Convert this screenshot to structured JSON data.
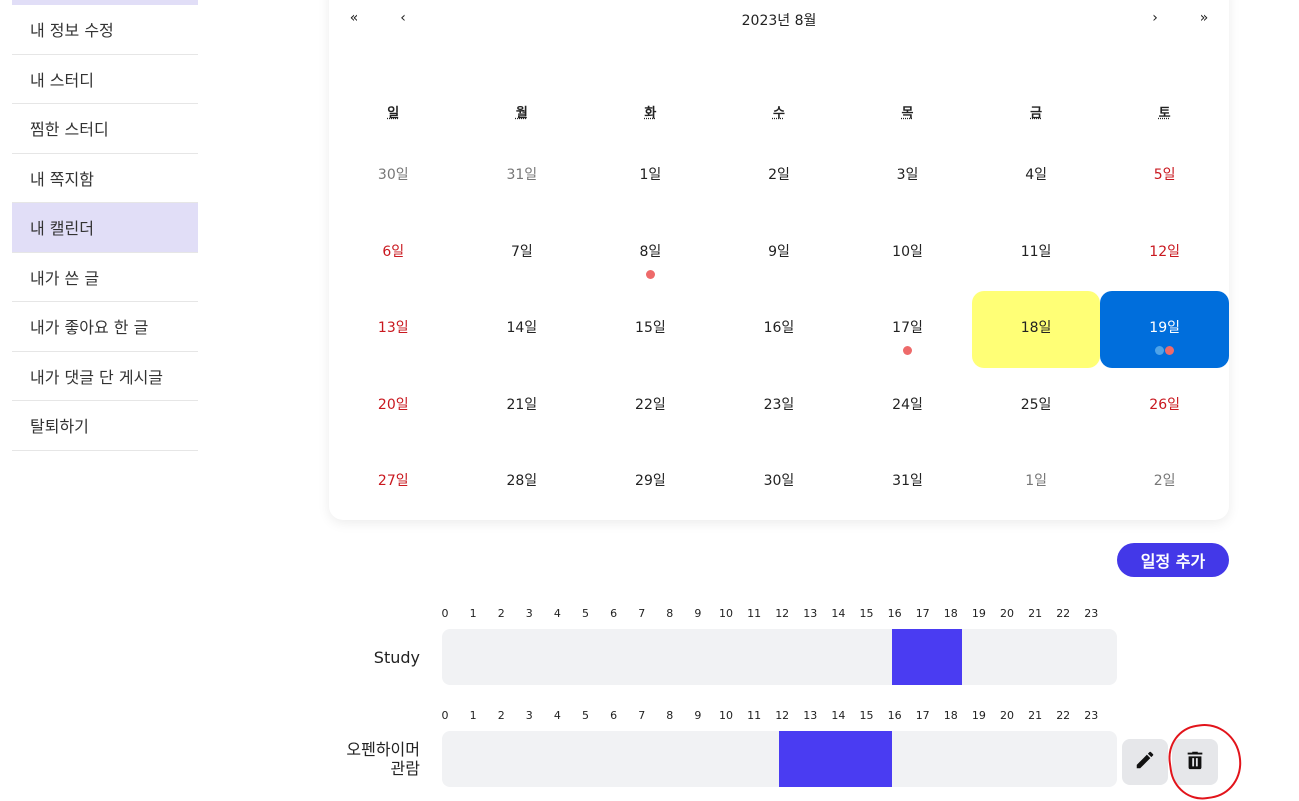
{
  "sidebar": {
    "items": [
      {
        "label": "내 정보 수정"
      },
      {
        "label": "내 스터디"
      },
      {
        "label": "찜한 스터디"
      },
      {
        "label": "내 쪽지함"
      },
      {
        "label": "내 캘린더"
      },
      {
        "label": "내가 쓴 글"
      },
      {
        "label": "내가 좋아요 한 글"
      },
      {
        "label": "내가 댓글 단 게시글"
      },
      {
        "label": "탈퇴하기"
      }
    ]
  },
  "calendar": {
    "title": "2023년 8월",
    "nav": {
      "prev2": "«",
      "prev": "‹",
      "next": "›",
      "next2": "»"
    },
    "weekdays": [
      "일",
      "월",
      "화",
      "수",
      "목",
      "금",
      "토"
    ],
    "weeks": [
      [
        {
          "label": "30일",
          "type": "neighbor"
        },
        {
          "label": "31일",
          "type": "neighbor"
        },
        {
          "label": "1일"
        },
        {
          "label": "2일"
        },
        {
          "label": "3일"
        },
        {
          "label": "4일"
        },
        {
          "label": "5일",
          "type": "weekend"
        }
      ],
      [
        {
          "label": "6일",
          "type": "weekend"
        },
        {
          "label": "7일"
        },
        {
          "label": "8일",
          "dots": [
            "#ee6a6a"
          ]
        },
        {
          "label": "9일"
        },
        {
          "label": "10일"
        },
        {
          "label": "11일"
        },
        {
          "label": "12일",
          "type": "weekend"
        }
      ],
      [
        {
          "label": "13일",
          "type": "weekend"
        },
        {
          "label": "14일"
        },
        {
          "label": "15일"
        },
        {
          "label": "16일"
        },
        {
          "label": "17일",
          "dots": [
            "#ee6a6a"
          ]
        },
        {
          "label": "18일",
          "type": "today"
        },
        {
          "label": "19일",
          "type": "selected",
          "dots": [
            "#4fa3e8",
            "#ee6a6a"
          ]
        }
      ],
      [
        {
          "label": "20일",
          "type": "weekend"
        },
        {
          "label": "21일"
        },
        {
          "label": "22일"
        },
        {
          "label": "23일"
        },
        {
          "label": "24일"
        },
        {
          "label": "25일"
        },
        {
          "label": "26일",
          "type": "weekend"
        }
      ],
      [
        {
          "label": "27일",
          "type": "weekend"
        },
        {
          "label": "28일"
        },
        {
          "label": "29일"
        },
        {
          "label": "30일"
        },
        {
          "label": "31일"
        },
        {
          "label": "1일",
          "type": "neighbor"
        },
        {
          "label": "2일",
          "type": "neighbor"
        }
      ]
    ]
  },
  "add_button": {
    "label": "일정 추가"
  },
  "hours": [
    "0",
    "1",
    "2",
    "3",
    "4",
    "5",
    "6",
    "7",
    "8",
    "9",
    "10",
    "11",
    "12",
    "13",
    "14",
    "15",
    "16",
    "17",
    "18",
    "19",
    "20",
    "21",
    "22",
    "23"
  ],
  "schedules": [
    {
      "name": "Study",
      "start": 16,
      "end": 18.5
    },
    {
      "name_lines": [
        "오펜하이머",
        "관람"
      ],
      "start": 12,
      "end": 16
    }
  ],
  "colors": {
    "accent": "#4338e8",
    "bar_fill": "#4a3cf2",
    "selected_day": "#006edc",
    "today": "#ffff76",
    "sidebar_active": "#e1def7",
    "weekend_text": "#c9181f"
  },
  "icons": {
    "edit": "pencil-icon",
    "delete": "trash-icon"
  }
}
